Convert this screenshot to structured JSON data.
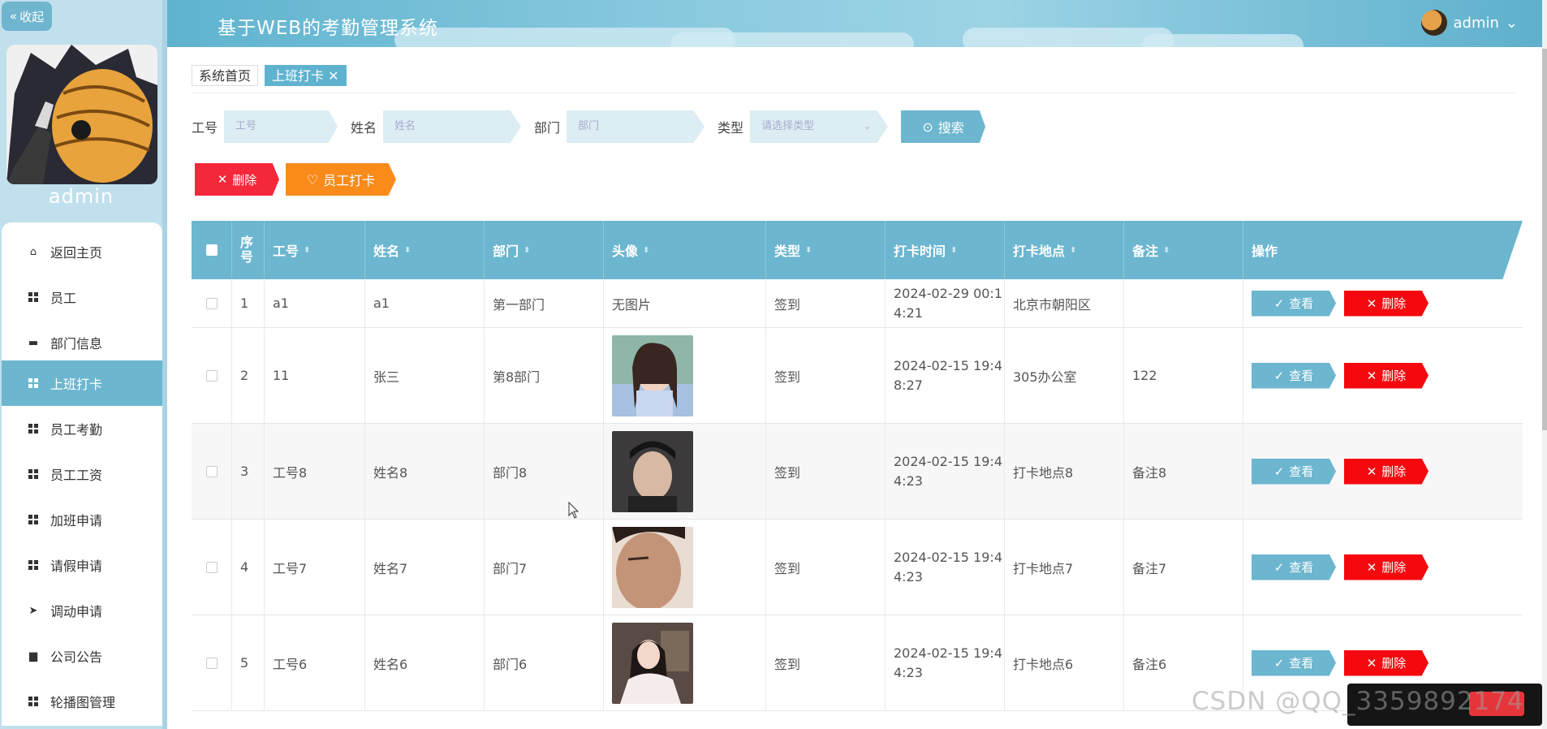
{
  "sidebar": {
    "collapse_label": "收起",
    "user_name": "admin",
    "items": [
      {
        "label": "返回主页",
        "icon": "home-icon"
      },
      {
        "label": "员工",
        "icon": "grid-icon"
      },
      {
        "label": "部门信息",
        "icon": "monitor-icon"
      },
      {
        "label": "上班打卡",
        "icon": "grid-icon",
        "active": true
      },
      {
        "label": "员工考勤",
        "icon": "grid-icon"
      },
      {
        "label": "员工工资",
        "icon": "grid-icon"
      },
      {
        "label": "加班申请",
        "icon": "grid-icon"
      },
      {
        "label": "请假申请",
        "icon": "grid-icon"
      },
      {
        "label": "调动申请",
        "icon": "send-icon"
      },
      {
        "label": "公司公告",
        "icon": "printer-icon"
      },
      {
        "label": "轮播图管理",
        "icon": "grid-icon"
      }
    ]
  },
  "header": {
    "title": "基于WEB的考勤管理系统",
    "user": "admin"
  },
  "tabs": {
    "home": "系统首页",
    "current": "上班打卡"
  },
  "search": {
    "emp_no_label": "工号",
    "emp_no_placeholder": "工号",
    "name_label": "姓名",
    "name_placeholder": "姓名",
    "dept_label": "部门",
    "dept_placeholder": "部门",
    "type_label": "类型",
    "type_placeholder": "请选择类型",
    "search_button": "搜索"
  },
  "actions": {
    "delete": "删除",
    "punch": "员工打卡"
  },
  "table": {
    "headers": {
      "index": "序号",
      "emp_no": "工号",
      "name": "姓名",
      "dept": "部门",
      "avatar": "头像",
      "type": "类型",
      "time": "打卡时间",
      "place": "打卡地点",
      "note": "备注",
      "ops": "操作"
    },
    "view_label": "查看",
    "delete_label": "删除",
    "rows": [
      {
        "index": "1",
        "emp_no": "a1",
        "name": "a1",
        "dept": "第一部门",
        "avatar_text": "无图片",
        "type": "签到",
        "time1": "2024-02-29 00:1",
        "time2": "4:21",
        "place": "北京市朝阳区",
        "note": ""
      },
      {
        "index": "2",
        "emp_no": "11",
        "name": "张三",
        "dept": "第8部门",
        "avatar_text": "",
        "type": "签到",
        "time1": "2024-02-15 19:4",
        "time2": "8:27",
        "place": "305办公室",
        "note": "122"
      },
      {
        "index": "3",
        "emp_no": "工号8",
        "name": "姓名8",
        "dept": "部门8",
        "avatar_text": "",
        "type": "签到",
        "time1": "2024-02-15 19:4",
        "time2": "4:23",
        "place": "打卡地点8",
        "note": "备注8"
      },
      {
        "index": "4",
        "emp_no": "工号7",
        "name": "姓名7",
        "dept": "部门7",
        "avatar_text": "",
        "type": "签到",
        "time1": "2024-02-15 19:4",
        "time2": "4:23",
        "place": "打卡地点7",
        "note": "备注7"
      },
      {
        "index": "5",
        "emp_no": "工号6",
        "name": "姓名6",
        "dept": "部门6",
        "avatar_text": "",
        "type": "签到",
        "time1": "2024-02-15 19:4",
        "time2": "4:23",
        "place": "打卡地点6",
        "note": "备注6"
      }
    ]
  },
  "watermark": "CSDN @QQ_3359892174",
  "colors": {
    "primary": "#6cb6cf",
    "danger": "#f5273a",
    "warning": "#f98b1b",
    "sidebar_bg": "#bfe0ec"
  }
}
